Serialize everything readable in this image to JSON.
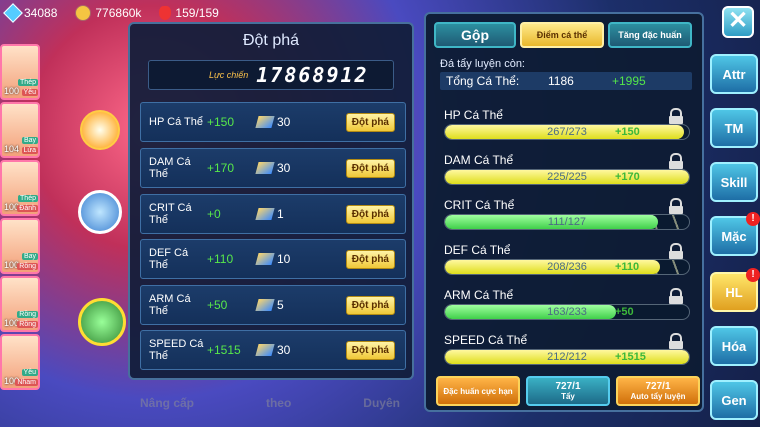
{
  "top": {
    "gems": "34088",
    "gold": "776860k",
    "stamina": "159/159"
  },
  "team": [
    {
      "level": "100",
      "tag": "Thép",
      "tag2": "Yêu"
    },
    {
      "level": "104",
      "tag": "Bay",
      "tag2": "Lửa"
    },
    {
      "level": "100",
      "tag": "Thép",
      "tag2": "Đánh"
    },
    {
      "level": "100",
      "tag": "Bay",
      "tag2": "Rồng"
    },
    {
      "level": "100",
      "tag": "Rồng",
      "tag2": "Rồng"
    },
    {
      "level": "100",
      "tag": "Yêu",
      "tag2": "Nham"
    }
  ],
  "bottom_tabs": [
    "Nâng cấp",
    "theo",
    "Duyên"
  ],
  "breakthrough": {
    "title": "Đột phá",
    "power_label": "Lực chiến",
    "power_value": "17868912",
    "rows": [
      {
        "name": "HP Cá Thể",
        "bonus": "+150",
        "count": "30",
        "button": "Đột phá"
      },
      {
        "name": "DAM Cá Thể",
        "bonus": "+170",
        "count": "30",
        "button": "Đột phá"
      },
      {
        "name": "CRIT Cá Thể",
        "bonus": "+0",
        "count": "1",
        "button": "Đột phá"
      },
      {
        "name": "DEF Cá Thể",
        "bonus": "+110",
        "count": "10",
        "button": "Đột phá"
      },
      {
        "name": "ARM Cá Thể",
        "bonus": "+50",
        "count": "5",
        "button": "Đột phá"
      },
      {
        "name": "SPEED Cá Thể",
        "bonus": "+1515",
        "count": "30",
        "button": "Đột phá"
      }
    ]
  },
  "iv_panel": {
    "tabs": [
      "Gộp",
      "Điểm cá thể",
      "Tăng đặc huấn"
    ],
    "subtitle": "Đá tẩy luyện còn:",
    "total_label": "Tổng Cá Thể:",
    "total_value": "1186",
    "total_add": "+1995",
    "stats": [
      {
        "name": "HP Cá Thể",
        "value": "267/273",
        "plus": "+150",
        "fill": 0.978,
        "color": "yellow"
      },
      {
        "name": "DAM Cá Thể",
        "value": "225/225",
        "plus": "+170",
        "fill": 1.0,
        "color": "yellow"
      },
      {
        "name": "CRIT Cá Thể",
        "value": "111/127",
        "plus": "",
        "fill": 0.874,
        "color": "green"
      },
      {
        "name": "DEF Cá Thể",
        "value": "208/236",
        "plus": "+110",
        "fill": 0.881,
        "color": "yellow"
      },
      {
        "name": "ARM Cá Thể",
        "value": "163/233",
        "plus": "+50",
        "fill": 0.7,
        "color": "green"
      },
      {
        "name": "SPEED Cá Thể",
        "value": "212/212",
        "plus": "+1515",
        "fill": 1.0,
        "color": "yellow"
      }
    ],
    "buttons": [
      {
        "label": "Đặc huấn cực hạn",
        "count": ""
      },
      {
        "label": "Tẩy",
        "count": "727/1"
      },
      {
        "label": "Auto tẩy luyện",
        "count": "727/1"
      }
    ]
  },
  "side_menu": [
    {
      "label": "Attr",
      "badge": ""
    },
    {
      "label": "TM",
      "badge": ""
    },
    {
      "label": "Skill",
      "badge": ""
    },
    {
      "label": "Mặc",
      "badge": "!"
    },
    {
      "label": "HL",
      "badge": "!"
    },
    {
      "label": "Hóa",
      "badge": ""
    },
    {
      "label": "Gen",
      "badge": ""
    }
  ],
  "close_label": "✕",
  "colors": {
    "accent_green": "#57e84a",
    "gold_button": "#f0c838",
    "panel_border": "#46709e"
  }
}
